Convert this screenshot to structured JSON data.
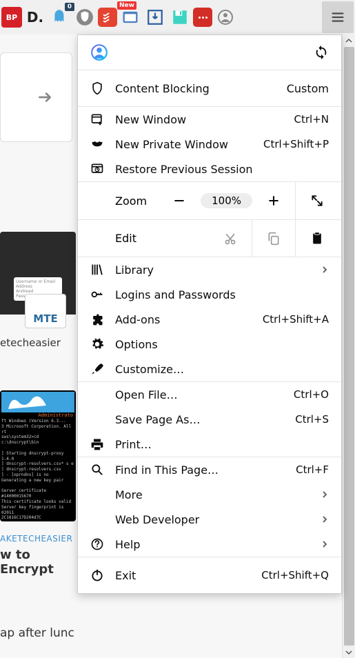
{
  "toolbar": {
    "ext_abp_label": "BP",
    "ext_d_label": "D.",
    "ext_ghostery_badge": "0",
    "ext_new_badge": "New"
  },
  "bg": {
    "mte_text": "MTE",
    "etecheasier": "etecheasier",
    "admin_text": "Administrato",
    "term_lines": "ft Windows (Version 6.3...\n3 Microsoft Corporation. All rt\nsws\\system32>cd c:\\dnscrypt\\bin\n\n] Starting dnscrypt-proxy 1.4.0\n] dnscrypt-resolvers.csv* s e\n] dnscrypt-resolvers.csv\n] - [oprndns] is no\nGenerating a new key pair\n\nServer certificate #14000015670\nThis certificate looks valid\nServer key fingerprint is 02011\n2C1816C17D204d7C",
    "caption_kicker": "AKETECHEASIER",
    "caption_title": "w to Encrypt",
    "bottom_text": "ap after lunc"
  },
  "menu": {
    "content_blocking": {
      "label": "Content Blocking",
      "value": "Custom"
    },
    "new_window": {
      "label": "New Window",
      "shortcut": "Ctrl+N"
    },
    "new_private": {
      "label": "New Private Window",
      "shortcut": "Ctrl+Shift+P"
    },
    "restore": {
      "label": "Restore Previous Session"
    },
    "zoom": {
      "label": "Zoom",
      "value": "100%"
    },
    "edit": {
      "label": "Edit"
    },
    "library": {
      "label": "Library"
    },
    "logins": {
      "label": "Logins and Passwords"
    },
    "addons": {
      "label": "Add-ons",
      "shortcut": "Ctrl+Shift+A"
    },
    "options": {
      "label": "Options"
    },
    "customize": {
      "label": "Customize…"
    },
    "open_file": {
      "label": "Open File…",
      "shortcut": "Ctrl+O"
    },
    "save_as": {
      "label": "Save Page As…",
      "shortcut": "Ctrl+S"
    },
    "print": {
      "label": "Print…"
    },
    "find": {
      "label": "Find in This Page…",
      "shortcut": "Ctrl+F"
    },
    "more": {
      "label": "More"
    },
    "webdev": {
      "label": "Web Developer"
    },
    "help": {
      "label": "Help"
    },
    "exit": {
      "label": "Exit",
      "shortcut": "Ctrl+Shift+Q"
    }
  }
}
